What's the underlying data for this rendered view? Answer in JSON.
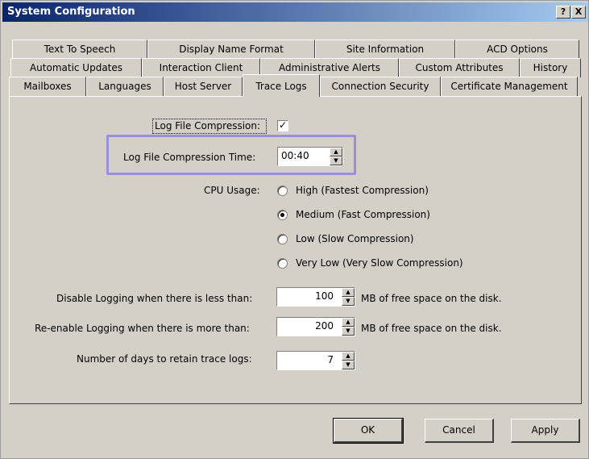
{
  "window": {
    "title": "System Configuration",
    "help_label": "?",
    "close_label": "X"
  },
  "tabs": {
    "row1": [
      "Text To Speech",
      "Display Name Format",
      "Site Information",
      "ACD Options"
    ],
    "row2": [
      "Automatic Updates",
      "Interaction Client",
      "Administrative Alerts",
      "Custom Attributes",
      "History"
    ],
    "row3": [
      "Mailboxes",
      "Languages",
      "Host Server",
      "Trace Logs",
      "Connection Security",
      "Certificate Management"
    ],
    "active": "Trace Logs"
  },
  "trace_logs": {
    "compression_label": "Log File Compression:",
    "compression_checked": true,
    "compression_time_label": "Log File Compression Time:",
    "compression_time_value": "00:40",
    "cpu_usage_label": "CPU Usage:",
    "cpu_options": [
      {
        "label": "High (Fastest Compression)",
        "selected": false
      },
      {
        "label": "Medium (Fast Compression)",
        "selected": true
      },
      {
        "label": "Low (Slow Compression)",
        "selected": false
      },
      {
        "label": "Very Low (Very Slow Compression)",
        "selected": false
      }
    ],
    "disable_label": "Disable Logging when there is less than:",
    "disable_value": "100",
    "disable_suffix": "MB of free space on the disk.",
    "reenable_label": "Re-enable Logging when there is more than:",
    "reenable_value": "200",
    "reenable_suffix": "MB of free space on the disk.",
    "retain_label": "Number of days to retain trace logs:",
    "retain_value": "7"
  },
  "buttons": {
    "ok": "OK",
    "cancel": "Cancel",
    "apply": "Apply"
  },
  "colors": {
    "highlight_border": "#9b8fd9",
    "titlebar_start": "#0a246a"
  }
}
